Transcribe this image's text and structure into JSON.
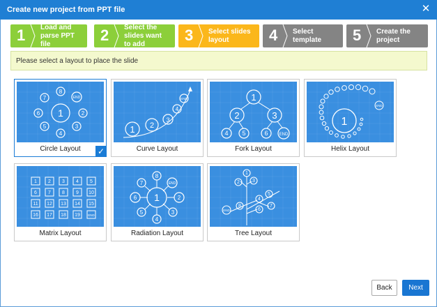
{
  "window": {
    "title": "Create new project from PPT file"
  },
  "steps": [
    {
      "num": "1",
      "label": "Load and parse PPT file",
      "state": "done"
    },
    {
      "num": "2",
      "label": "Select the slides want to add",
      "state": "done"
    },
    {
      "num": "3",
      "label": "Select slides layout",
      "state": "active"
    },
    {
      "num": "4",
      "label": "Select template",
      "state": "todo"
    },
    {
      "num": "5",
      "label": "Create the project",
      "state": "todo"
    }
  ],
  "hint": "Please select a layout to place the slide",
  "layouts": [
    {
      "name": "Circle Layout",
      "selected": true
    },
    {
      "name": "Curve Layout",
      "selected": false
    },
    {
      "name": "Fork Layout",
      "selected": false
    },
    {
      "name": "Helix Layout",
      "selected": false
    },
    {
      "name": "Matrix Layout",
      "selected": false
    },
    {
      "name": "Radiation Layout",
      "selected": false
    },
    {
      "name": "Tree Layout",
      "selected": false
    }
  ],
  "thumb_text": {
    "circle": {
      "center": "1",
      "nodes": [
        "2",
        "3",
        "4",
        "5",
        "6",
        "7",
        "8",
        "END"
      ]
    },
    "curve": {
      "nodes": [
        "1",
        "2",
        "3",
        "4",
        "END"
      ]
    },
    "fork": {
      "nodes": [
        "1",
        "2",
        "3",
        "4",
        "5",
        "6",
        "END"
      ]
    },
    "helix": {
      "center": "1",
      "end": "END"
    },
    "matrix": {
      "cells": [
        "1",
        "2",
        "3",
        "4",
        "5",
        "6",
        "7",
        "8",
        "9",
        "10",
        "11",
        "12",
        "13",
        "14",
        "15",
        "16",
        "17",
        "18",
        "19",
        "END"
      ]
    },
    "radiation": {
      "center": "1",
      "nodes": [
        "2",
        "3",
        "4",
        "5",
        "6",
        "7",
        "8",
        "END"
      ]
    },
    "tree": {
      "nodes": [
        "1",
        "2",
        "3",
        "4",
        "5",
        "6",
        "7",
        "8",
        "END"
      ]
    }
  },
  "buttons": {
    "back": "Back",
    "next": "Next"
  },
  "colors": {
    "titlebar": "#1f7fd4",
    "step_done": "#8ccf3a",
    "step_active": "#fbb71b",
    "step_todo": "#848484",
    "thumb_bg": "#3a8fe0",
    "primary_button": "#1976d2"
  },
  "icons": {
    "close": "close-icon",
    "check": "check-icon"
  }
}
